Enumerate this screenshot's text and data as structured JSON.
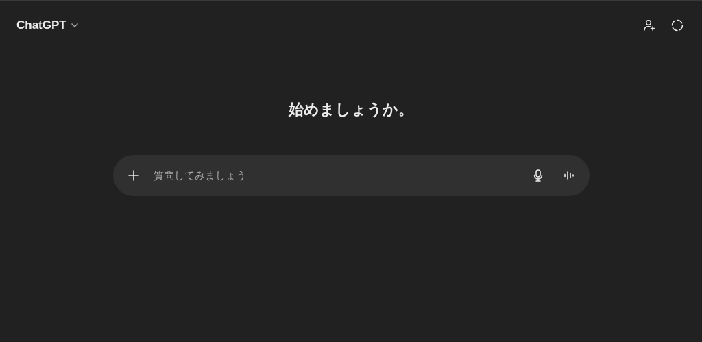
{
  "header": {
    "title": "ChatGPT"
  },
  "greeting": "始めましょうか。",
  "composer": {
    "placeholder": "質問してみましょう"
  }
}
